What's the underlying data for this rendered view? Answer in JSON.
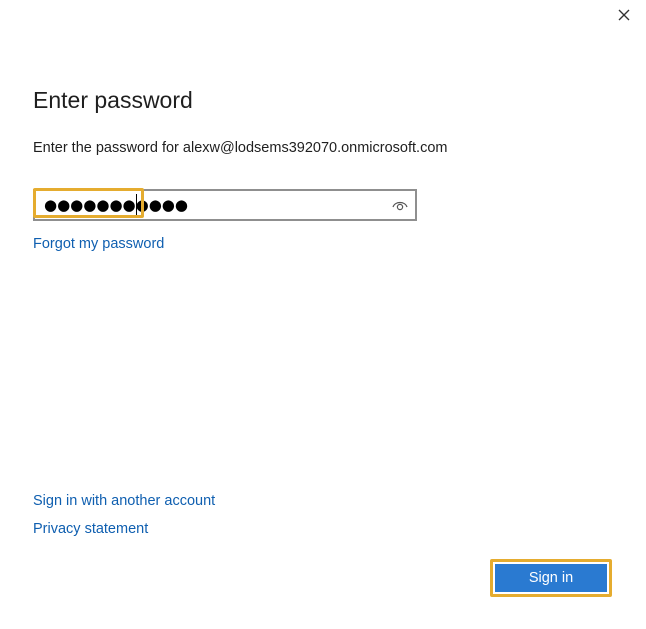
{
  "dialog": {
    "close_icon": "close-icon",
    "title": "Enter password",
    "subtitle": "Enter the password for alexw@lodsems392070.onmicrosoft.com",
    "password": {
      "masked_value": "●●●●●●●●●●●",
      "reveal_icon": "eye-icon"
    },
    "forgot_link": "Forgot my password",
    "other_account_link": "Sign in with another account",
    "privacy_link": "Privacy statement",
    "sign_in_button": "Sign in",
    "colors": {
      "link": "#0f5fb0",
      "primary_button": "#2a7ad1",
      "focus_highlight": "#e5ac2f"
    }
  }
}
